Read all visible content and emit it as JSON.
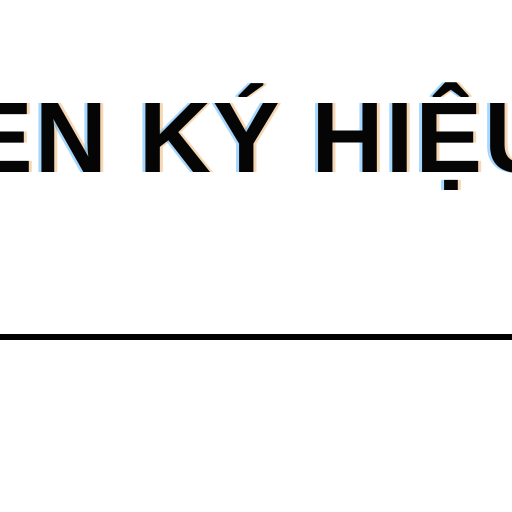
{
  "heading": {
    "text": "EN KÝ HIỆU"
  },
  "colors": {
    "text": "#050505",
    "rule": "#000000",
    "background": "#ffffff"
  }
}
